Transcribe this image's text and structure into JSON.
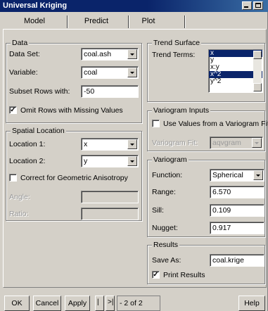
{
  "window": {
    "title": "Universal Kriging"
  },
  "tabs": [
    {
      "label": "Model",
      "active": true
    },
    {
      "label": "Predict",
      "active": false
    },
    {
      "label": "Plot",
      "active": false
    }
  ],
  "data_group": {
    "legend": "Data",
    "data_set_label": "Data Set:",
    "data_set_value": "coal.ash",
    "variable_label": "Variable:",
    "variable_value": "coal",
    "subset_label": "Subset Rows with:",
    "subset_value": "-50",
    "omit_label": "Omit Rows with Missing Values",
    "omit_checked": true
  },
  "spatial_group": {
    "legend": "Spatial Location",
    "location1_label": "Location 1:",
    "location1_value": "x",
    "location2_label": "Location 2:",
    "location2_value": "y",
    "correct_label": "Correct for Geometric Anisotropy",
    "correct_checked": false,
    "angle_label": "Angle:",
    "ratio_label": "Ratio:"
  },
  "trend_group": {
    "legend": "Trend Surface",
    "terms_label": "Trend Terms:",
    "terms": [
      {
        "label": "x",
        "selected": true
      },
      {
        "label": "y",
        "selected": false
      },
      {
        "label": "x:y",
        "selected": false
      },
      {
        "label": "x^2",
        "selected": true
      },
      {
        "label": "y^2",
        "selected": false
      }
    ]
  },
  "variogram_inputs_group": {
    "legend": "Variogram Inputs",
    "use_values_label": "Use Values from a Variogram Fit",
    "use_values_checked": false,
    "fit_label": "Variogram Fit:",
    "fit_value": "aqvgram"
  },
  "variogram_group": {
    "legend": "Variogram",
    "function_label": "Function:",
    "function_value": "Spherical",
    "range_label": "Range:",
    "range_value": "6.570",
    "sill_label": "Sill:",
    "sill_value": "0.109",
    "nugget_label": "Nugget:",
    "nugget_value": "0.917"
  },
  "results_group": {
    "legend": "Results",
    "save_as_label": "Save As:",
    "save_as_value": "coal.krige",
    "print_label": "Print Results",
    "print_checked": true
  },
  "buttons": {
    "ok": "OK",
    "cancel": "Cancel",
    "apply": "Apply",
    "page_indicator": "2 of 2",
    "help": "Help"
  }
}
